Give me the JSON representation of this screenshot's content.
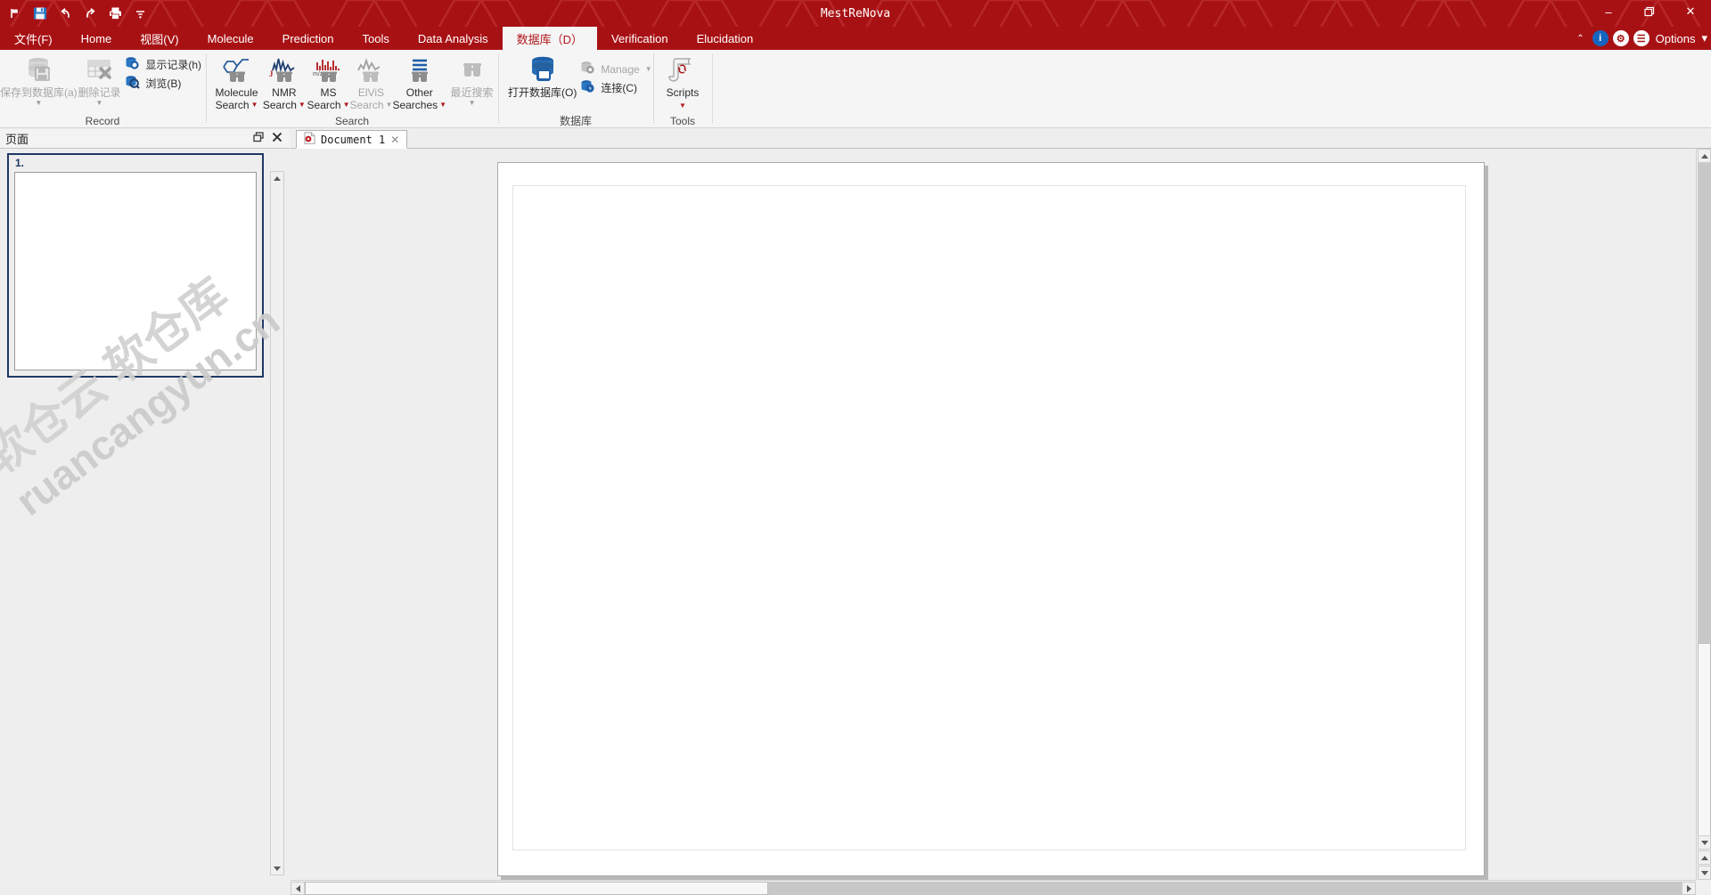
{
  "window": {
    "title": "MestReNova",
    "accent_color": "#a81114",
    "controls": {
      "minimize": "–",
      "restore": "❐",
      "close": "✕"
    }
  },
  "quick_access": {
    "items": [
      {
        "name": "flag-icon",
        "glyph": "⚑"
      },
      {
        "name": "save-icon",
        "glyph": "💾"
      },
      {
        "name": "undo-icon",
        "glyph": "↶"
      },
      {
        "name": "redo-icon",
        "glyph": "↷"
      },
      {
        "name": "print-icon",
        "glyph": "⎙"
      },
      {
        "name": "customize-qat-icon",
        "glyph": "≡"
      }
    ]
  },
  "menu": {
    "tabs": [
      {
        "label": "文件(F)",
        "active": false
      },
      {
        "label": "Home",
        "active": false
      },
      {
        "label": "视图(V)",
        "active": false
      },
      {
        "label": "Molecule",
        "active": false
      },
      {
        "label": "Prediction",
        "active": false
      },
      {
        "label": "Tools",
        "active": false
      },
      {
        "label": "Data Analysis",
        "active": false
      },
      {
        "label": "数据库（D）",
        "active": true
      },
      {
        "label": "Verification",
        "active": false
      },
      {
        "label": "Elucidation",
        "active": false
      }
    ],
    "right": {
      "collapse_caret": "⌃",
      "info_glyph": "i",
      "gear_glyph": "⚙",
      "book_glyph": "☰",
      "options_label": "Options",
      "options_caret": "▾"
    }
  },
  "ribbon": {
    "groups": [
      {
        "name": "record",
        "label": "Record",
        "big_buttons": [
          {
            "name": "save-to-database-button",
            "label1": "保存到数据库(a)",
            "label2": "",
            "disabled": true,
            "has_caret": true
          },
          {
            "name": "delete-record-button",
            "label1": "删除记录",
            "label2": "",
            "disabled": true,
            "has_caret": true
          }
        ],
        "small_buttons": [
          {
            "name": "show-records-button",
            "label": "显示记录(h)",
            "disabled": false
          },
          {
            "name": "browse-button",
            "label": "浏览(B)",
            "disabled": false
          }
        ]
      },
      {
        "name": "search",
        "label": "Search",
        "big_buttons": [
          {
            "name": "molecule-search-button",
            "label1": "Molecule",
            "label2": "Search",
            "disabled": false,
            "has_caret": true
          },
          {
            "name": "nmr-search-button",
            "label1": "NMR",
            "label2": "Search",
            "disabled": false,
            "has_caret": true
          },
          {
            "name": "ms-search-button",
            "label1": "MS",
            "label2": "Search",
            "disabled": false,
            "has_caret": true
          },
          {
            "name": "elvis-search-button",
            "label1": "ElViS",
            "label2": "Search",
            "disabled": true,
            "has_caret": true
          },
          {
            "name": "other-searches-button",
            "label1": "Other",
            "label2": "Searches",
            "disabled": false,
            "has_caret": true
          },
          {
            "name": "recent-searches-button",
            "label1": "最近搜索",
            "label2": "",
            "disabled": true,
            "has_caret": true
          }
        ],
        "small_buttons": []
      },
      {
        "name": "database",
        "label": "数据库",
        "big_buttons": [
          {
            "name": "open-database-button",
            "label1": "打开数据库(O)",
            "label2": "",
            "disabled": false,
            "has_caret": false
          }
        ],
        "small_buttons": [
          {
            "name": "manage-button",
            "label": "Manage",
            "disabled": true,
            "has_caret": true
          },
          {
            "name": "connect-button",
            "label": "连接(C)",
            "disabled": false,
            "has_caret": false
          }
        ]
      },
      {
        "name": "tools",
        "label": "Tools",
        "big_buttons": [
          {
            "name": "scripts-button",
            "label1": "Scripts",
            "label2": "",
            "disabled": false,
            "has_caret": true
          }
        ],
        "small_buttons": []
      }
    ]
  },
  "pages_panel": {
    "title": "页面",
    "float_glyph": "❐",
    "close_glyph": "✕",
    "pages": [
      {
        "number": "1."
      }
    ]
  },
  "document_area": {
    "tabs": [
      {
        "name": "document-tab",
        "label": "Document 1",
        "close_glyph": "✕",
        "active": true
      }
    ]
  },
  "watermark": {
    "line1": "软仓云 软仓库",
    "line2": "ruancangyun.cn"
  }
}
